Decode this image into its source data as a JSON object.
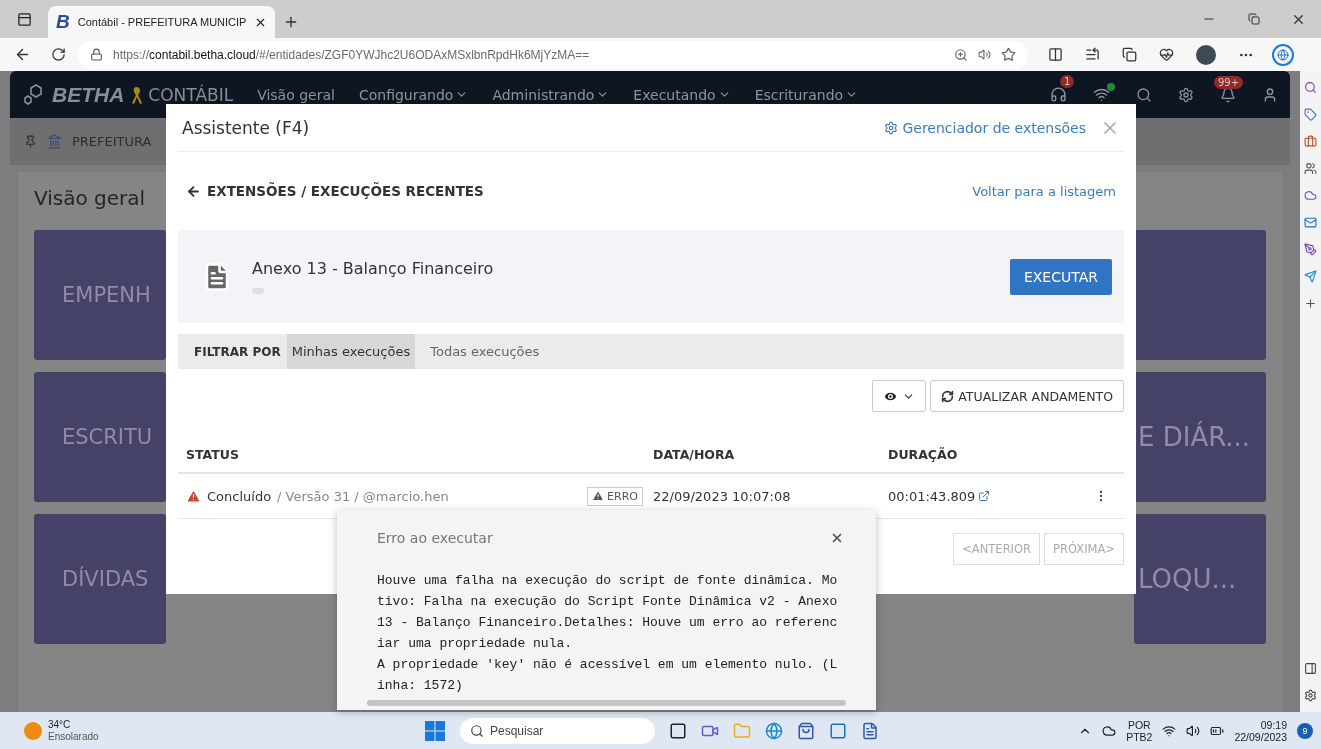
{
  "browser": {
    "tabs": [
      {
        "favicon": "B",
        "title": "Contábil - PREFEITURA MUNICIP",
        "selected": true
      }
    ],
    "address": {
      "scheme": "https://",
      "host": "contabil.betha.cloud",
      "path": "/#/entidades/ZGF0YWJhc2U6ODAxMSxlbnRpdHk6MjYzMA=="
    }
  },
  "app": {
    "brand": "BETHA",
    "product": "CONTÁBIL",
    "menu": [
      {
        "label": "Visão geral",
        "dropdown": false
      },
      {
        "label": "Configurando",
        "dropdown": true
      },
      {
        "label": "Administrando",
        "dropdown": true
      },
      {
        "label": "Executando",
        "dropdown": true
      },
      {
        "label": "Escriturando",
        "dropdown": true
      }
    ],
    "support_badge": "1",
    "alerts_badge": "99+",
    "entity": "PREFEITURA",
    "page_title": "Visão geral",
    "tiles": [
      {
        "kind": "left",
        "label": "EMPENH"
      },
      {
        "kind": "right"
      },
      {
        "kind": "left",
        "label": "ESCRITU"
      },
      {
        "kind": "right",
        "label": "E DIÁR..."
      },
      {
        "kind": "left",
        "label": "DÍVIDAS"
      },
      {
        "kind": "right",
        "label": "LOQU..."
      }
    ]
  },
  "assistant": {
    "title": "Assistente (F4)",
    "manager_link": "Gerenciador de extensões",
    "breadcrumb": "EXTENSÕES / EXECUÇÕES RECENTES",
    "back_link": "Voltar para a listagem",
    "extension": {
      "name": "Anexo 13 - Balanço Financeiro"
    },
    "run_button": "EXECUTAR",
    "filter": {
      "label": "FILTRAR POR",
      "options": [
        {
          "label": "Minhas execuções",
          "selected": true
        },
        {
          "label": "Todas execuções",
          "selected": false
        }
      ]
    },
    "refresh_button": "ATUALIZAR ANDAMENTO",
    "table": {
      "columns": [
        "STATUS",
        "DATA/HORA",
        "DURAÇÃO"
      ],
      "rows": [
        {
          "kind": "warning",
          "status": "Concluído",
          "meta": "/ Versão 31 / @marcio.hen",
          "badge": "ERRO",
          "datetime": "22/09/2023 10:07:08",
          "duration": "00:01:43.809"
        }
      ]
    },
    "pagination": [
      {
        "label": "<ANTERIOR",
        "disabled": true
      },
      {
        "label": "PRÓXIMA>",
        "disabled": true
      }
    ]
  },
  "error_popover": {
    "title": "Erro ao executar",
    "message": "Houve uma falha na execução do script de fonte dinâmica. Motivo: Falha na execução do Script Fonte Dinâmica v2 - Anexo 13 - Balanço Financeiro.Detalhes: Houve um erro ao referenciar uma propriedade nula.\nA propriedade 'key' não é acessível em um elemento nulo. (Linha: 1572)"
  },
  "taskbar": {
    "temperature": "34°C",
    "weather": "Ensolarado",
    "search_placeholder": "Pesquisar",
    "language": "POR",
    "layout": "PTB2",
    "time": "09:19",
    "date": "22/09/2023",
    "notification_count": "9"
  }
}
